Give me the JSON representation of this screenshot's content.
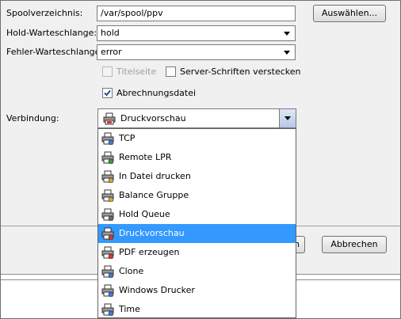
{
  "form": {
    "spool_label": "Spoolverzeichnis:",
    "spool_value": "/var/spool/ppv",
    "browse_label": "Auswählen...",
    "hold_label": "Hold-Warteschlange:",
    "hold_value": "hold",
    "error_label": "Fehler-Warteschlange:",
    "error_value": "error",
    "title_page_label": "Titelseite",
    "title_page_checked": false,
    "title_page_enabled": false,
    "hide_fonts_label": "Server-Schriften verstecken",
    "hide_fonts_checked": false,
    "billing_label": "Abrechnungsdatei",
    "billing_checked": true,
    "connection_label": "Verbindung:",
    "connection_value": "Druckvorschau"
  },
  "dropdown": {
    "selected_index": 5,
    "items": [
      {
        "label": "TCP",
        "icon": "printer-network-icon"
      },
      {
        "label": "Remote LPR",
        "icon": "printer-remote-icon"
      },
      {
        "label": "In Datei drucken",
        "icon": "printer-file-icon"
      },
      {
        "label": "Balance Gruppe",
        "icon": "printer-group-icon"
      },
      {
        "label": "Hold Queue",
        "icon": "printer-hold-icon"
      },
      {
        "label": "Druckvorschau",
        "icon": "printer-preview-icon"
      },
      {
        "label": "PDF erzeugen",
        "icon": "printer-pdf-icon"
      },
      {
        "label": "Clone",
        "icon": "printer-clone-icon"
      },
      {
        "label": "Windows Drucker",
        "icon": "printer-windows-icon"
      },
      {
        "label": "Time",
        "icon": "printer-time-icon"
      }
    ]
  },
  "footer": {
    "ok_partial_label": "n",
    "cancel_label": "Abbrechen"
  },
  "colors": {
    "selection": "#3399ff",
    "panel": "#f0f0f0"
  }
}
